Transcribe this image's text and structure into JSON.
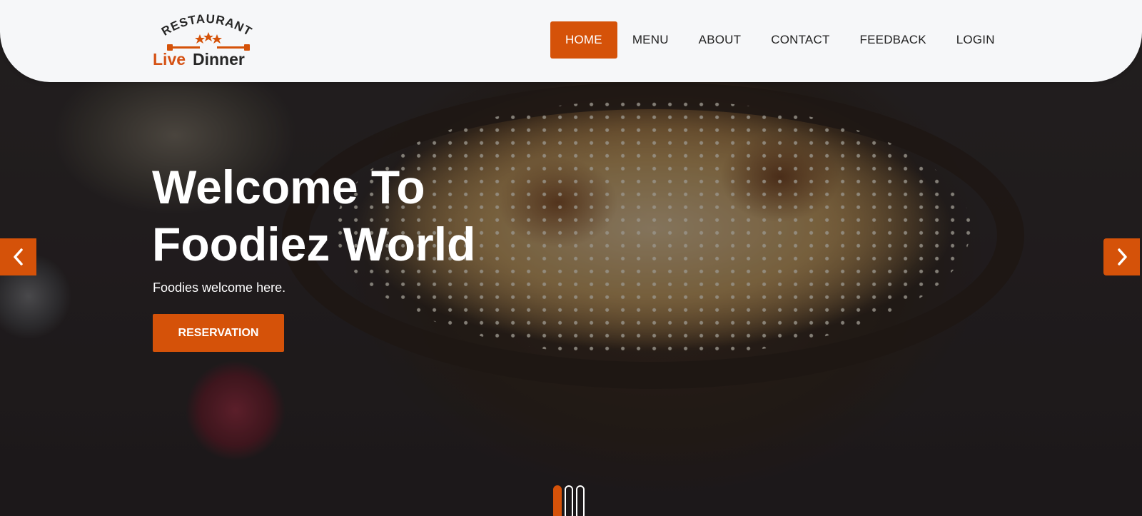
{
  "brand": {
    "arc_text": "RESTAURANT",
    "name_part1": "Live",
    "name_part2": "Dinner",
    "accent_color": "#d55209"
  },
  "nav": {
    "items": [
      {
        "label": "HOME",
        "active": true
      },
      {
        "label": "MENU",
        "active": false
      },
      {
        "label": "ABOUT",
        "active": false
      },
      {
        "label": "CONTACT",
        "active": false
      },
      {
        "label": "FEEDBACK",
        "active": false
      },
      {
        "label": "LOGIN",
        "active": false
      }
    ]
  },
  "hero": {
    "title_line1": "Welcome To",
    "title_line2": "Foodiez World",
    "subtitle": "Foodies welcome here.",
    "cta_label": "RESERVATION"
  },
  "carousel": {
    "prev_icon": "chevron-left-icon",
    "next_icon": "chevron-right-icon",
    "slide_count": 3,
    "active_slide": 1
  }
}
